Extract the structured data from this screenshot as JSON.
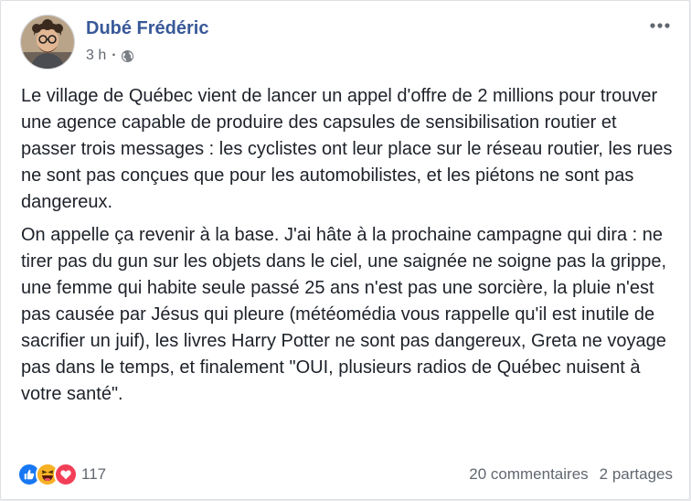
{
  "post": {
    "author": "Dubé Frédéric",
    "time": "3 h",
    "separator": "·",
    "privacy_icon": "globe-icon",
    "paragraphs": [
      "Le village de Québec vient de lancer un appel d'offre de 2 millions pour trouver une agence capable de produire des capsules de sensibilisation routier et passer trois messages : les cyclistes ont leur place sur le réseau routier, les rues ne sont pas conçues que pour les automobilistes, et les piétons ne sont pas dangereux.",
      "On appelle ça revenir à la base. J'ai hâte à la prochaine campagne qui dira : ne tirer pas du gun sur les objets dans le ciel, une saignée ne soigne pas la grippe, une femme qui habite seule passé 25 ans n'est pas une sorcière, la pluie n'est pas causée par Jésus qui pleure (météomédia vous rappelle qu'il est inutile de sacrifier un juif), les livres Harry Potter ne sont pas dangereux, Greta ne voyage pas dans le temps, et finalement \"OUI, plusieurs radios de Québec nuisent à votre santé\"."
    ]
  },
  "footer": {
    "reaction_icons": [
      "like-icon",
      "haha-icon",
      "love-icon"
    ],
    "reaction_count": "117",
    "comments": "20 commentaires",
    "shares": "2 partages"
  },
  "colors": {
    "author": "#385898",
    "meta": "#616770",
    "text": "#1d2129",
    "like": "#1877f2",
    "haha": "#f7b125",
    "love": "#f33e58"
  }
}
